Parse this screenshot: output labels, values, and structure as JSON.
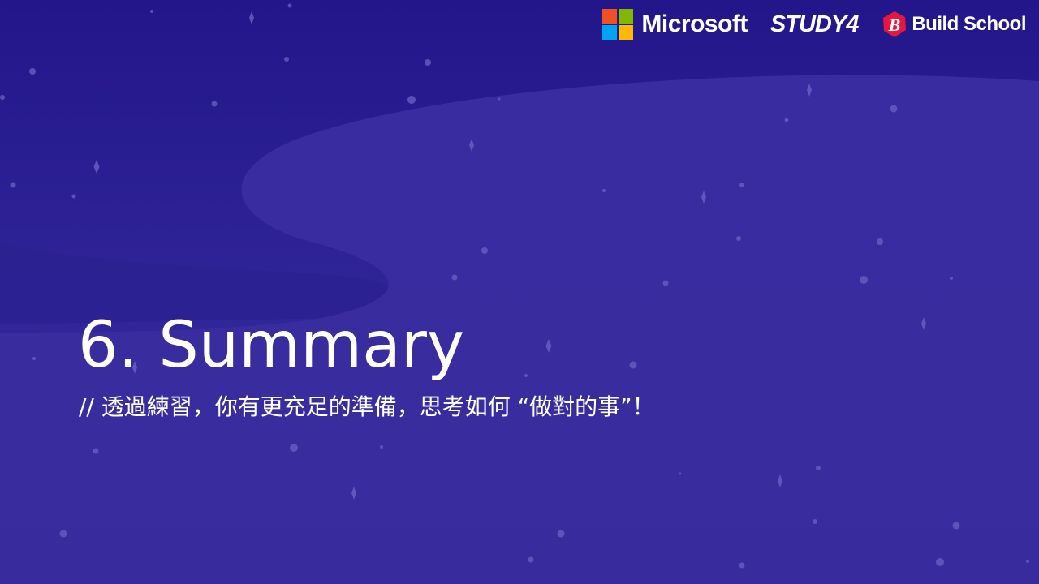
{
  "logos": {
    "microsoft": {
      "text": "Microsoft",
      "colors": [
        "#f25022",
        "#7fba00",
        "#00a4ef",
        "#ffb900"
      ]
    },
    "study4": {
      "text": "STUDY4"
    },
    "build_school": {
      "text": "Build School",
      "badge_letter": "B",
      "badge_color": "#e5173f"
    }
  },
  "slide": {
    "title": "6. Summary",
    "subtitle": "// 透過練習，你有更充足的準備，思考如何 “做對的事”！"
  },
  "theme": {
    "background_top": "#22168a",
    "background_bottom": "#362b9c",
    "wave_color": "#3a2ea0",
    "text_color": "#ffffff"
  }
}
